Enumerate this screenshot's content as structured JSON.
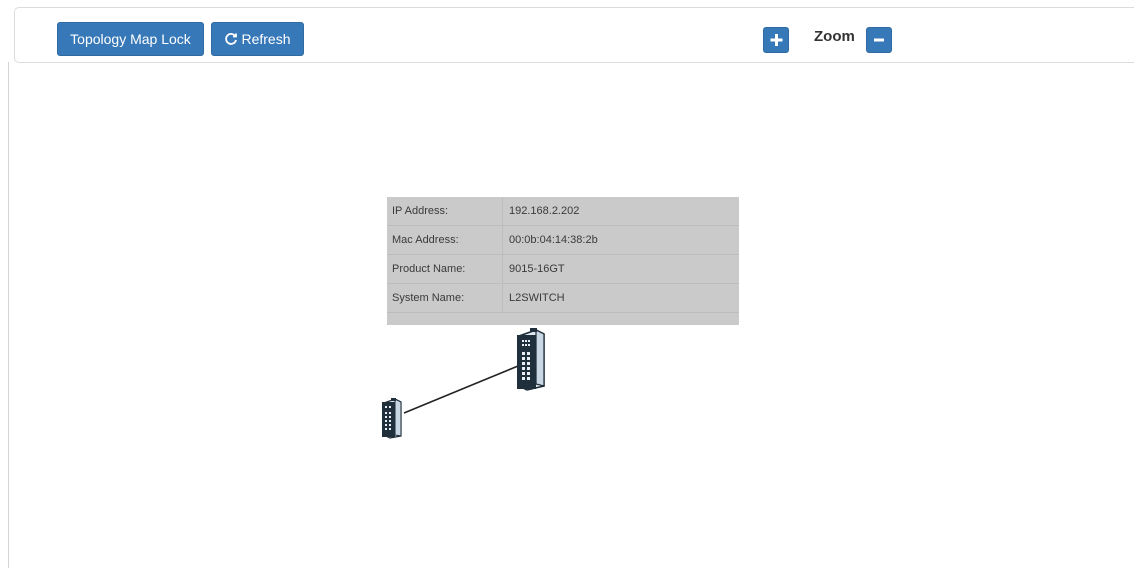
{
  "toolbar": {
    "lock_label": "Topology Map Lock",
    "refresh_label": "Refresh",
    "zoom_label": "Zoom",
    "zoom_in_icon": "plus-icon",
    "zoom_out_icon": "minus-icon",
    "accent_color": "#3778b8"
  },
  "device_info": {
    "rows": [
      {
        "label": "IP Address:",
        "value": "192.168.2.202"
      },
      {
        "label": "Mac Address:",
        "value": "00:0b:04:14:38:2b"
      },
      {
        "label": "Product Name:",
        "value": "9015-16GT"
      },
      {
        "label": "System Name:",
        "value": "L2SWITCH"
      }
    ]
  },
  "topology": {
    "nodes": [
      {
        "id": "switch-main",
        "icon": "switch-icon"
      },
      {
        "id": "switch-secondary",
        "icon": "switch-icon"
      }
    ],
    "links": [
      {
        "from": "switch-main",
        "to": "switch-secondary"
      }
    ]
  }
}
